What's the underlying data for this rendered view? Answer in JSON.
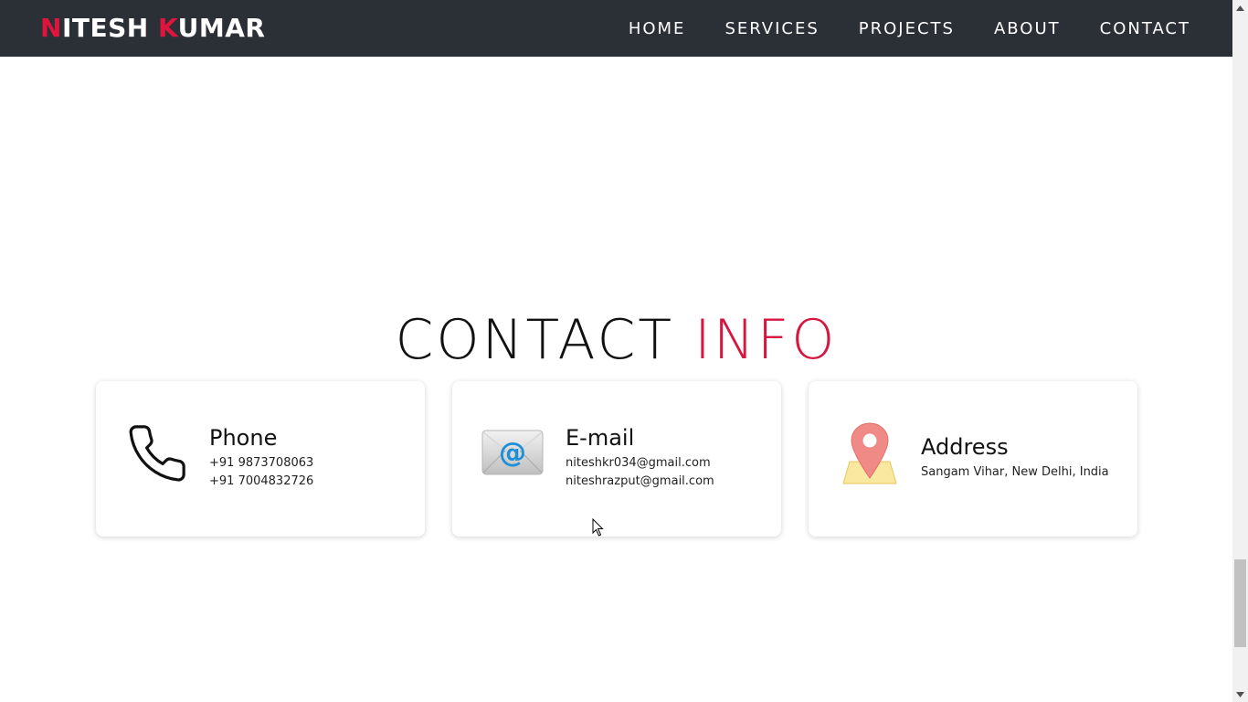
{
  "brand": {
    "first_initial": "N",
    "first_rest": "ITESH",
    "last_initial": "K",
    "last_rest": "UMAR",
    "accent_color": "#e0143c"
  },
  "nav": {
    "items": [
      {
        "label": "HOME"
      },
      {
        "label": "SERVICES"
      },
      {
        "label": "PROJECTS"
      },
      {
        "label": "ABOUT"
      },
      {
        "label": "CONTACT"
      }
    ],
    "background": "#2b2f36"
  },
  "contact": {
    "title_main": "CONTACT",
    "title_accent": "INFO",
    "cards": {
      "phone": {
        "icon": "phone-icon",
        "heading": "Phone",
        "lines": [
          "+91 9873708063",
          "+91 7004832726"
        ]
      },
      "email": {
        "icon": "email-icon",
        "heading": "E-mail",
        "lines": [
          "niteshkr034@gmail.com",
          "niteshrazput@gmail.com"
        ]
      },
      "address": {
        "icon": "map-pin-icon",
        "heading": "Address",
        "lines": [
          "Sangam Vihar, New Delhi, India"
        ]
      }
    }
  }
}
